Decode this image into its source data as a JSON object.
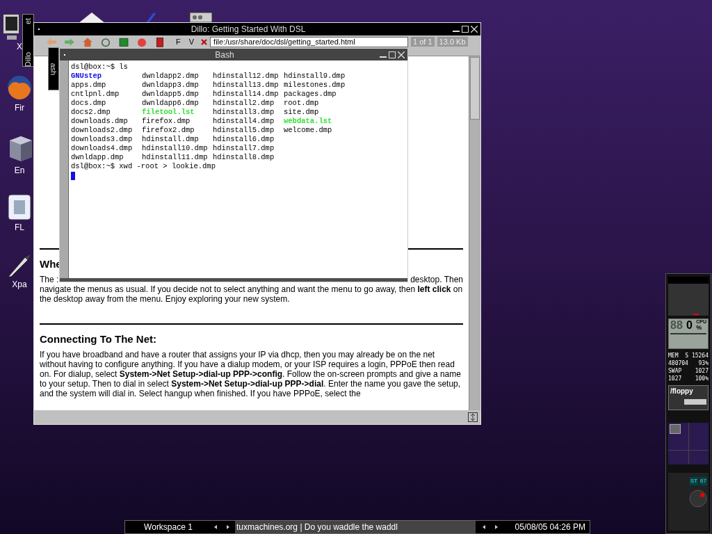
{
  "desktop_icons": [
    {
      "label": "X",
      "kind": "monitor"
    },
    {
      "label": "Fir",
      "kind": "firefox"
    },
    {
      "label": "En",
      "kind": "cube"
    },
    {
      "label": "FL",
      "kind": "app"
    },
    {
      "label": "Xpa",
      "kind": "brush"
    }
  ],
  "minimized": [
    {
      "labels": [
        "Dillo",
        "et"
      ]
    },
    {
      "labels": [
        "ash"
      ]
    }
  ],
  "dillo": {
    "title": "Dillo: Getting Started With DSL",
    "menus": [
      "F",
      "V"
    ],
    "url": "file:/usr/share/doc/dsl/getting_started.html",
    "page": "1 of 1",
    "size": "13.0 Kb",
    "sections": [
      {
        "heading": "Whe",
        "paragraph": "The :",
        "paragraph_end": "desktop. Then",
        "continuation": "navigate the menus as usual. If you decide not to select anything and want the menu to go away, then **left click** on the desktop away from the menu. Enjoy exploring your new system."
      },
      {
        "heading": "Connecting To The Net:",
        "continuation": "If you have broadband and have a router that assigns your IP via dhcp, then you may already be on the net without having to configure anything. If you have a dialup modem, or your ISP requires a login, PPPoE then read on. For dialup, select **System->Net Setup->dial-up PPP->config**. Follow the on-screen prompts and give a name to your setup. Then to dial in select **System->Net Setup->dial-up PPP->dial**. Enter the name you gave the setup, and the system will dial in. Select hangup when finished. If you have PPPoE, select the"
      }
    ]
  },
  "bash": {
    "title": "Bash",
    "lines": [
      {
        "kind": "prompt",
        "text": "dsl@box:~$ ls"
      },
      {
        "kind": "listing",
        "cells": [
          {
            "text": "GNUstep",
            "kind": "dir"
          },
          {
            "text": "dwnldapp2.dmp",
            "kind": "file"
          },
          {
            "text": "hdinstall12.dmp",
            "kind": "file"
          },
          {
            "text": "hdinstall9.dmp",
            "kind": "file"
          }
        ]
      },
      {
        "kind": "listing",
        "cells": [
          {
            "text": "apps.dmp",
            "kind": "file"
          },
          {
            "text": "dwnldapp3.dmp",
            "kind": "file"
          },
          {
            "text": "hdinstall13.dmp",
            "kind": "file"
          },
          {
            "text": "milestones.dmp",
            "kind": "file"
          }
        ]
      },
      {
        "kind": "listing",
        "cells": [
          {
            "text": "cntlpnl.dmp",
            "kind": "file"
          },
          {
            "text": "dwnldapp5.dmp",
            "kind": "file"
          },
          {
            "text": "hdinstall14.dmp",
            "kind": "file"
          },
          {
            "text": "packages.dmp",
            "kind": "file"
          }
        ]
      },
      {
        "kind": "listing",
        "cells": [
          {
            "text": "docs.dmp",
            "kind": "file"
          },
          {
            "text": "dwnldapp6.dmp",
            "kind": "file"
          },
          {
            "text": "hdinstall2.dmp",
            "kind": "file"
          },
          {
            "text": "root.dmp",
            "kind": "file"
          }
        ]
      },
      {
        "kind": "listing",
        "cells": [
          {
            "text": "docs2.dmp",
            "kind": "file"
          },
          {
            "text": "filetool.lst",
            "kind": "exec"
          },
          {
            "text": "hdinstall3.dmp",
            "kind": "file"
          },
          {
            "text": "site.dmp",
            "kind": "file"
          }
        ]
      },
      {
        "kind": "listing",
        "cells": [
          {
            "text": "downloads.dmp",
            "kind": "file"
          },
          {
            "text": "firefox.dmp",
            "kind": "file"
          },
          {
            "text": "hdinstall4.dmp",
            "kind": "file"
          },
          {
            "text": "webdata.lst",
            "kind": "exec"
          }
        ]
      },
      {
        "kind": "listing",
        "cells": [
          {
            "text": "downloads2.dmp",
            "kind": "file"
          },
          {
            "text": "firefox2.dmp",
            "kind": "file"
          },
          {
            "text": "hdinstall5.dmp",
            "kind": "file"
          },
          {
            "text": "welcome.dmp",
            "kind": "file"
          }
        ]
      },
      {
        "kind": "listing",
        "cells": [
          {
            "text": "downloads3.dmp",
            "kind": "file"
          },
          {
            "text": "hdinstall.dmp",
            "kind": "file"
          },
          {
            "text": "hdinstall6.dmp",
            "kind": "file"
          }
        ]
      },
      {
        "kind": "listing",
        "cells": [
          {
            "text": "downloads4.dmp",
            "kind": "file"
          },
          {
            "text": "hdinstall10.dmp",
            "kind": "file"
          },
          {
            "text": "hdinstall7.dmp",
            "kind": "file"
          }
        ]
      },
      {
        "kind": "listing",
        "cells": [
          {
            "text": "dwnldapp.dmp",
            "kind": "file"
          },
          {
            "text": "hdinstall11.dmp",
            "kind": "file"
          },
          {
            "text": "hdinstall8.dmp",
            "kind": "file"
          }
        ]
      },
      {
        "kind": "prompt",
        "text": "dsl@box:~$ xwd -root > lookie.dmp"
      }
    ]
  },
  "dock": {
    "cpu_label": "CPU",
    "cpu_digits": "88",
    "cpu_value": "0",
    "cpu_unit": "%",
    "mem_rows": [
      [
        "MEM",
        "S 15264"
      ],
      [
        "480704",
        "93%"
      ],
      [
        "SWAP",
        "1027"
      ],
      [
        "1027",
        "100%"
      ]
    ],
    "mount": "/floppy",
    "mixer": [
      "ST",
      "67"
    ]
  },
  "taskbar": {
    "workspace": "Workspace 1",
    "ticker": "tuxmachines.org | Do you waddle the waddl",
    "clock": "05/08/05 04:26 PM"
  }
}
